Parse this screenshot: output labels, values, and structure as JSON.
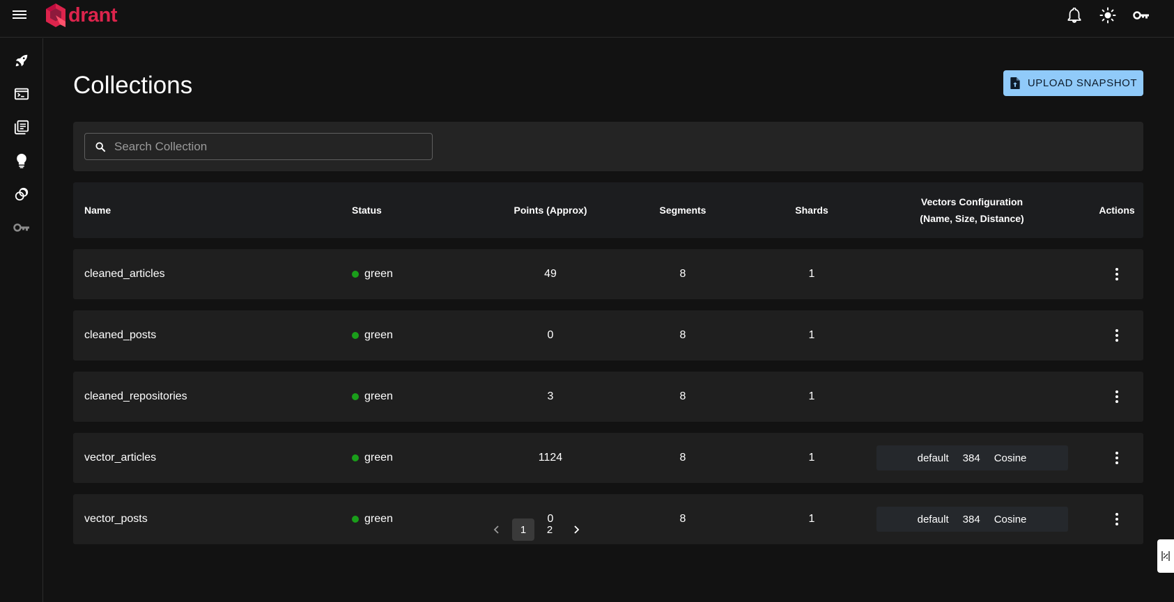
{
  "app": {
    "logo_text": "drant",
    "brand_color": "#dc244c",
    "accent_color": "#90caf9"
  },
  "topbar_icons": [
    "bell-icon",
    "sun-icon",
    "key-icon"
  ],
  "sidebar_icons": [
    "rocket-icon",
    "console-icon",
    "library-icon",
    "lightbulb-icon",
    "datasets-icon",
    "key-icon"
  ],
  "page": {
    "title": "Collections",
    "upload_label": "UPLOAD SNAPSHOT"
  },
  "search": {
    "placeholder": "Search Collection",
    "value": ""
  },
  "table": {
    "headers": {
      "name": "Name",
      "status": "Status",
      "points": "Points (Approx)",
      "segments": "Segments",
      "shards": "Shards",
      "vectors_line1": "Vectors Configuration",
      "vectors_line2": "(Name, Size, Distance)",
      "actions": "Actions"
    },
    "rows": [
      {
        "name": "cleaned_articles",
        "status": "green",
        "points": "49",
        "segments": "8",
        "shards": "1",
        "vec_name": "",
        "vec_size": "",
        "vec_distance": ""
      },
      {
        "name": "cleaned_posts",
        "status": "green",
        "points": "0",
        "segments": "8",
        "shards": "1",
        "vec_name": "",
        "vec_size": "",
        "vec_distance": ""
      },
      {
        "name": "cleaned_repositories",
        "status": "green",
        "points": "3",
        "segments": "8",
        "shards": "1",
        "vec_name": "",
        "vec_size": "",
        "vec_distance": ""
      },
      {
        "name": "vector_articles",
        "status": "green",
        "points": "1124",
        "segments": "8",
        "shards": "1",
        "vec_name": "default",
        "vec_size": "384",
        "vec_distance": "Cosine"
      },
      {
        "name": "vector_posts",
        "status": "green",
        "points": "0",
        "segments": "8",
        "shards": "1",
        "vec_name": "default",
        "vec_size": "384",
        "vec_distance": "Cosine"
      }
    ]
  },
  "pagination": {
    "pages": [
      "1",
      "2"
    ],
    "current": "1"
  }
}
